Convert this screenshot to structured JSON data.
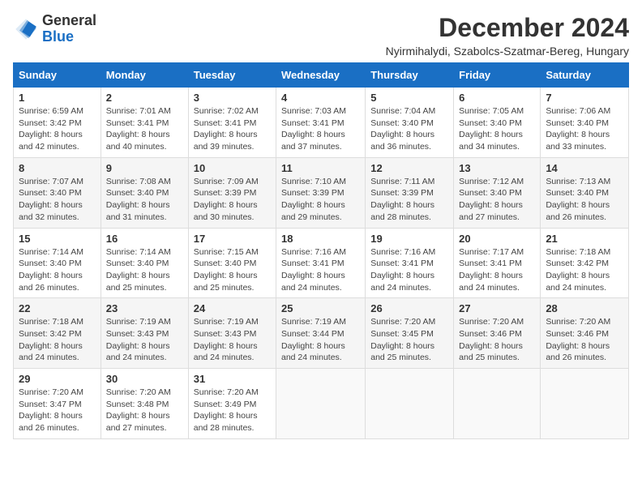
{
  "logo": {
    "general": "General",
    "blue": "Blue"
  },
  "title": "December 2024",
  "location": "Nyirmihalydi, Szabolcs-Szatmar-Bereg, Hungary",
  "weekdays": [
    "Sunday",
    "Monday",
    "Tuesday",
    "Wednesday",
    "Thursday",
    "Friday",
    "Saturday"
  ],
  "weeks": [
    [
      {
        "day": "1",
        "sunrise": "Sunrise: 6:59 AM",
        "sunset": "Sunset: 3:42 PM",
        "daylight": "Daylight: 8 hours and 42 minutes."
      },
      {
        "day": "2",
        "sunrise": "Sunrise: 7:01 AM",
        "sunset": "Sunset: 3:41 PM",
        "daylight": "Daylight: 8 hours and 40 minutes."
      },
      {
        "day": "3",
        "sunrise": "Sunrise: 7:02 AM",
        "sunset": "Sunset: 3:41 PM",
        "daylight": "Daylight: 8 hours and 39 minutes."
      },
      {
        "day": "4",
        "sunrise": "Sunrise: 7:03 AM",
        "sunset": "Sunset: 3:41 PM",
        "daylight": "Daylight: 8 hours and 37 minutes."
      },
      {
        "day": "5",
        "sunrise": "Sunrise: 7:04 AM",
        "sunset": "Sunset: 3:40 PM",
        "daylight": "Daylight: 8 hours and 36 minutes."
      },
      {
        "day": "6",
        "sunrise": "Sunrise: 7:05 AM",
        "sunset": "Sunset: 3:40 PM",
        "daylight": "Daylight: 8 hours and 34 minutes."
      },
      {
        "day": "7",
        "sunrise": "Sunrise: 7:06 AM",
        "sunset": "Sunset: 3:40 PM",
        "daylight": "Daylight: 8 hours and 33 minutes."
      }
    ],
    [
      {
        "day": "8",
        "sunrise": "Sunrise: 7:07 AM",
        "sunset": "Sunset: 3:40 PM",
        "daylight": "Daylight: 8 hours and 32 minutes."
      },
      {
        "day": "9",
        "sunrise": "Sunrise: 7:08 AM",
        "sunset": "Sunset: 3:40 PM",
        "daylight": "Daylight: 8 hours and 31 minutes."
      },
      {
        "day": "10",
        "sunrise": "Sunrise: 7:09 AM",
        "sunset": "Sunset: 3:39 PM",
        "daylight": "Daylight: 8 hours and 30 minutes."
      },
      {
        "day": "11",
        "sunrise": "Sunrise: 7:10 AM",
        "sunset": "Sunset: 3:39 PM",
        "daylight": "Daylight: 8 hours and 29 minutes."
      },
      {
        "day": "12",
        "sunrise": "Sunrise: 7:11 AM",
        "sunset": "Sunset: 3:39 PM",
        "daylight": "Daylight: 8 hours and 28 minutes."
      },
      {
        "day": "13",
        "sunrise": "Sunrise: 7:12 AM",
        "sunset": "Sunset: 3:40 PM",
        "daylight": "Daylight: 8 hours and 27 minutes."
      },
      {
        "day": "14",
        "sunrise": "Sunrise: 7:13 AM",
        "sunset": "Sunset: 3:40 PM",
        "daylight": "Daylight: 8 hours and 26 minutes."
      }
    ],
    [
      {
        "day": "15",
        "sunrise": "Sunrise: 7:14 AM",
        "sunset": "Sunset: 3:40 PM",
        "daylight": "Daylight: 8 hours and 26 minutes."
      },
      {
        "day": "16",
        "sunrise": "Sunrise: 7:14 AM",
        "sunset": "Sunset: 3:40 PM",
        "daylight": "Daylight: 8 hours and 25 minutes."
      },
      {
        "day": "17",
        "sunrise": "Sunrise: 7:15 AM",
        "sunset": "Sunset: 3:40 PM",
        "daylight": "Daylight: 8 hours and 25 minutes."
      },
      {
        "day": "18",
        "sunrise": "Sunrise: 7:16 AM",
        "sunset": "Sunset: 3:41 PM",
        "daylight": "Daylight: 8 hours and 24 minutes."
      },
      {
        "day": "19",
        "sunrise": "Sunrise: 7:16 AM",
        "sunset": "Sunset: 3:41 PM",
        "daylight": "Daylight: 8 hours and 24 minutes."
      },
      {
        "day": "20",
        "sunrise": "Sunrise: 7:17 AM",
        "sunset": "Sunset: 3:41 PM",
        "daylight": "Daylight: 8 hours and 24 minutes."
      },
      {
        "day": "21",
        "sunrise": "Sunrise: 7:18 AM",
        "sunset": "Sunset: 3:42 PM",
        "daylight": "Daylight: 8 hours and 24 minutes."
      }
    ],
    [
      {
        "day": "22",
        "sunrise": "Sunrise: 7:18 AM",
        "sunset": "Sunset: 3:42 PM",
        "daylight": "Daylight: 8 hours and 24 minutes."
      },
      {
        "day": "23",
        "sunrise": "Sunrise: 7:19 AM",
        "sunset": "Sunset: 3:43 PM",
        "daylight": "Daylight: 8 hours and 24 minutes."
      },
      {
        "day": "24",
        "sunrise": "Sunrise: 7:19 AM",
        "sunset": "Sunset: 3:43 PM",
        "daylight": "Daylight: 8 hours and 24 minutes."
      },
      {
        "day": "25",
        "sunrise": "Sunrise: 7:19 AM",
        "sunset": "Sunset: 3:44 PM",
        "daylight": "Daylight: 8 hours and 24 minutes."
      },
      {
        "day": "26",
        "sunrise": "Sunrise: 7:20 AM",
        "sunset": "Sunset: 3:45 PM",
        "daylight": "Daylight: 8 hours and 25 minutes."
      },
      {
        "day": "27",
        "sunrise": "Sunrise: 7:20 AM",
        "sunset": "Sunset: 3:46 PM",
        "daylight": "Daylight: 8 hours and 25 minutes."
      },
      {
        "day": "28",
        "sunrise": "Sunrise: 7:20 AM",
        "sunset": "Sunset: 3:46 PM",
        "daylight": "Daylight: 8 hours and 26 minutes."
      }
    ],
    [
      {
        "day": "29",
        "sunrise": "Sunrise: 7:20 AM",
        "sunset": "Sunset: 3:47 PM",
        "daylight": "Daylight: 8 hours and 26 minutes."
      },
      {
        "day": "30",
        "sunrise": "Sunrise: 7:20 AM",
        "sunset": "Sunset: 3:48 PM",
        "daylight": "Daylight: 8 hours and 27 minutes."
      },
      {
        "day": "31",
        "sunrise": "Sunrise: 7:20 AM",
        "sunset": "Sunset: 3:49 PM",
        "daylight": "Daylight: 8 hours and 28 minutes."
      },
      null,
      null,
      null,
      null
    ]
  ]
}
